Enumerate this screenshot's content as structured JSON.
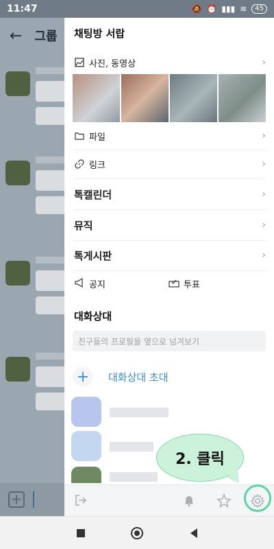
{
  "status": {
    "time": "11:47",
    "battery": "45"
  },
  "background": {
    "title": "그룹"
  },
  "drawer": {
    "title": "채팅방 서랍",
    "media_label": "사진, 동영상",
    "file_label": "파일",
    "link_label": "링크",
    "calendar_label": "톡캘린더",
    "music_label": "뮤직",
    "board_label": "톡게시판",
    "notice_label": "공지",
    "vote_label": "투표",
    "members_title": "대화상대",
    "search_placeholder": "친구들의 프로필을 옆으로 넘겨보기",
    "invite_label": "대화상대 초대"
  },
  "annotation": {
    "text": "2. 클릭"
  },
  "colors": {
    "accent": "#3c8be0",
    "highlight": "#55d7a1",
    "bubble": "#ccf2dc"
  }
}
